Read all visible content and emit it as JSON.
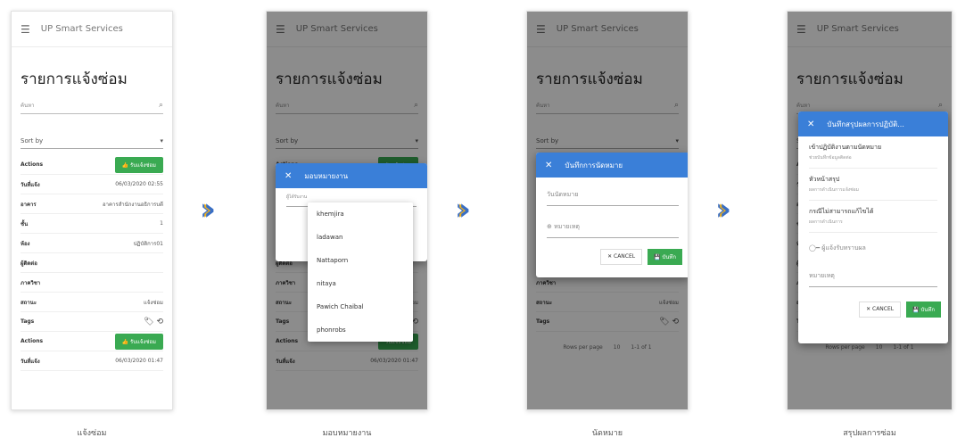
{
  "app_title": "UP Smart Services",
  "page_title": "รายการแจ้งซ่อม",
  "search_placeholder": "ค้นหา",
  "sort_label": "Sort by",
  "actions_label": "Actions",
  "accept_btn": "รับแจ้งซ่อม",
  "rows1": [
    {
      "k": "วันที่แจ้ง",
      "v": "06/03/2020 02:55"
    },
    {
      "k": "อาคาร",
      "v": "อาคารสำนักงานอธิการบดี"
    },
    {
      "k": "ชั้น",
      "v": "1"
    },
    {
      "k": "ห้อง",
      "v": "ปฏิบัติการ01"
    },
    {
      "k": "ผู้ติดต่อ",
      "v": ""
    },
    {
      "k": "ภาควิชา",
      "v": ""
    },
    {
      "k": "สถานะ",
      "v": "แจ้งซ่อม"
    }
  ],
  "tags_label": "Tags",
  "date2_label": "วันที่แจ้ง",
  "date2_value": "06/03/2020 01:47",
  "assign_title": "มอบหมายงาน",
  "assign_field": "ผู้ได้รับงาน",
  "assign_people": [
    "khemjira",
    "ladawan",
    "Nattaporn",
    "nitaya",
    "Pawich Chaibal",
    "phonrobs"
  ],
  "appoint_title": "บันทึกการนัดหมาย",
  "appoint_date": "วันนัดหมาย",
  "appoint_note": "หมายเหตุ",
  "cancel_label": "CANCEL",
  "save_label": "บันทึก",
  "summary_title": "บันทึกสรุปผลการปฏิบัติ...",
  "summary_items": [
    {
      "t": "เข้าปฏิบัติงานตามนัดหมาย",
      "s": "ช่วยบันทึกข้อมูลติดต่อ"
    },
    {
      "t": "หัวหน้าสรุป",
      "s": "ผลการดำเนินการแจ้งซ่อม"
    },
    {
      "t": "กรณีไม่สามารถแก้ไขได้",
      "s": "ผลการดำเนินการ"
    }
  ],
  "summary_toggle": "ผู้แจ้งรับทราบผล",
  "summary_note": "หมายเหตุ",
  "rows_per_page": "Rows per page",
  "rows_per_page_value": "10",
  "page_range": "1-1 of 1",
  "captions": [
    "แจ้งซ่อม",
    "มอบหมายงาน",
    "นัดหมาย",
    "สรุปผลการซ่อม"
  ],
  "colors": {
    "accent": "#3a7fd8",
    "success": "#3aaa52",
    "arrow_blue": "#3a6fc4",
    "arrow_yellow": "#f2b21b"
  }
}
